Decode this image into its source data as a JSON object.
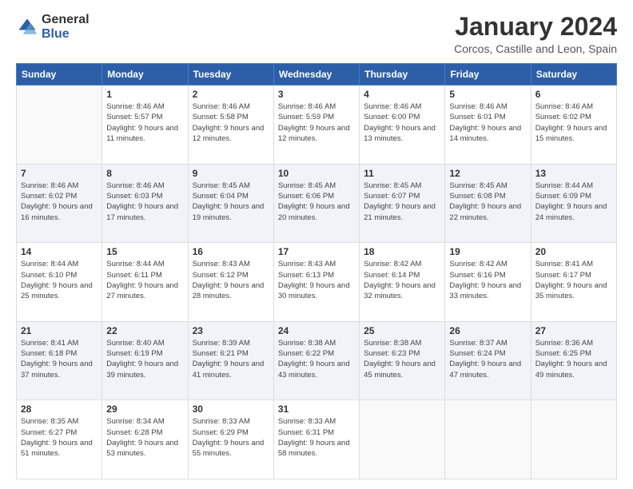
{
  "logo": {
    "general": "General",
    "blue": "Blue"
  },
  "title": "January 2024",
  "location": "Corcos, Castille and Leon, Spain",
  "days_header": [
    "Sunday",
    "Monday",
    "Tuesday",
    "Wednesday",
    "Thursday",
    "Friday",
    "Saturday"
  ],
  "weeks": [
    [
      {
        "day": "",
        "sunrise": "",
        "sunset": "",
        "daylight": ""
      },
      {
        "day": "1",
        "sunrise": "Sunrise: 8:46 AM",
        "sunset": "Sunset: 5:57 PM",
        "daylight": "Daylight: 9 hours and 11 minutes."
      },
      {
        "day": "2",
        "sunrise": "Sunrise: 8:46 AM",
        "sunset": "Sunset: 5:58 PM",
        "daylight": "Daylight: 9 hours and 12 minutes."
      },
      {
        "day": "3",
        "sunrise": "Sunrise: 8:46 AM",
        "sunset": "Sunset: 5:59 PM",
        "daylight": "Daylight: 9 hours and 12 minutes."
      },
      {
        "day": "4",
        "sunrise": "Sunrise: 8:46 AM",
        "sunset": "Sunset: 6:00 PM",
        "daylight": "Daylight: 9 hours and 13 minutes."
      },
      {
        "day": "5",
        "sunrise": "Sunrise: 8:46 AM",
        "sunset": "Sunset: 6:01 PM",
        "daylight": "Daylight: 9 hours and 14 minutes."
      },
      {
        "day": "6",
        "sunrise": "Sunrise: 8:46 AM",
        "sunset": "Sunset: 6:02 PM",
        "daylight": "Daylight: 9 hours and 15 minutes."
      }
    ],
    [
      {
        "day": "7",
        "sunrise": "Sunrise: 8:46 AM",
        "sunset": "Sunset: 6:02 PM",
        "daylight": "Daylight: 9 hours and 16 minutes."
      },
      {
        "day": "8",
        "sunrise": "Sunrise: 8:46 AM",
        "sunset": "Sunset: 6:03 PM",
        "daylight": "Daylight: 9 hours and 17 minutes."
      },
      {
        "day": "9",
        "sunrise": "Sunrise: 8:45 AM",
        "sunset": "Sunset: 6:04 PM",
        "daylight": "Daylight: 9 hours and 19 minutes."
      },
      {
        "day": "10",
        "sunrise": "Sunrise: 8:45 AM",
        "sunset": "Sunset: 6:06 PM",
        "daylight": "Daylight: 9 hours and 20 minutes."
      },
      {
        "day": "11",
        "sunrise": "Sunrise: 8:45 AM",
        "sunset": "Sunset: 6:07 PM",
        "daylight": "Daylight: 9 hours and 21 minutes."
      },
      {
        "day": "12",
        "sunrise": "Sunrise: 8:45 AM",
        "sunset": "Sunset: 6:08 PM",
        "daylight": "Daylight: 9 hours and 22 minutes."
      },
      {
        "day": "13",
        "sunrise": "Sunrise: 8:44 AM",
        "sunset": "Sunset: 6:09 PM",
        "daylight": "Daylight: 9 hours and 24 minutes."
      }
    ],
    [
      {
        "day": "14",
        "sunrise": "Sunrise: 8:44 AM",
        "sunset": "Sunset: 6:10 PM",
        "daylight": "Daylight: 9 hours and 25 minutes."
      },
      {
        "day": "15",
        "sunrise": "Sunrise: 8:44 AM",
        "sunset": "Sunset: 6:11 PM",
        "daylight": "Daylight: 9 hours and 27 minutes."
      },
      {
        "day": "16",
        "sunrise": "Sunrise: 8:43 AM",
        "sunset": "Sunset: 6:12 PM",
        "daylight": "Daylight: 9 hours and 28 minutes."
      },
      {
        "day": "17",
        "sunrise": "Sunrise: 8:43 AM",
        "sunset": "Sunset: 6:13 PM",
        "daylight": "Daylight: 9 hours and 30 minutes."
      },
      {
        "day": "18",
        "sunrise": "Sunrise: 8:42 AM",
        "sunset": "Sunset: 6:14 PM",
        "daylight": "Daylight: 9 hours and 32 minutes."
      },
      {
        "day": "19",
        "sunrise": "Sunrise: 8:42 AM",
        "sunset": "Sunset: 6:16 PM",
        "daylight": "Daylight: 9 hours and 33 minutes."
      },
      {
        "day": "20",
        "sunrise": "Sunrise: 8:41 AM",
        "sunset": "Sunset: 6:17 PM",
        "daylight": "Daylight: 9 hours and 35 minutes."
      }
    ],
    [
      {
        "day": "21",
        "sunrise": "Sunrise: 8:41 AM",
        "sunset": "Sunset: 6:18 PM",
        "daylight": "Daylight: 9 hours and 37 minutes."
      },
      {
        "day": "22",
        "sunrise": "Sunrise: 8:40 AM",
        "sunset": "Sunset: 6:19 PM",
        "daylight": "Daylight: 9 hours and 39 minutes."
      },
      {
        "day": "23",
        "sunrise": "Sunrise: 8:39 AM",
        "sunset": "Sunset: 6:21 PM",
        "daylight": "Daylight: 9 hours and 41 minutes."
      },
      {
        "day": "24",
        "sunrise": "Sunrise: 8:38 AM",
        "sunset": "Sunset: 6:22 PM",
        "daylight": "Daylight: 9 hours and 43 minutes."
      },
      {
        "day": "25",
        "sunrise": "Sunrise: 8:38 AM",
        "sunset": "Sunset: 6:23 PM",
        "daylight": "Daylight: 9 hours and 45 minutes."
      },
      {
        "day": "26",
        "sunrise": "Sunrise: 8:37 AM",
        "sunset": "Sunset: 6:24 PM",
        "daylight": "Daylight: 9 hours and 47 minutes."
      },
      {
        "day": "27",
        "sunrise": "Sunrise: 8:36 AM",
        "sunset": "Sunset: 6:25 PM",
        "daylight": "Daylight: 9 hours and 49 minutes."
      }
    ],
    [
      {
        "day": "28",
        "sunrise": "Sunrise: 8:35 AM",
        "sunset": "Sunset: 6:27 PM",
        "daylight": "Daylight: 9 hours and 51 minutes."
      },
      {
        "day": "29",
        "sunrise": "Sunrise: 8:34 AM",
        "sunset": "Sunset: 6:28 PM",
        "daylight": "Daylight: 9 hours and 53 minutes."
      },
      {
        "day": "30",
        "sunrise": "Sunrise: 8:33 AM",
        "sunset": "Sunset: 6:29 PM",
        "daylight": "Daylight: 9 hours and 55 minutes."
      },
      {
        "day": "31",
        "sunrise": "Sunrise: 8:33 AM",
        "sunset": "Sunset: 6:31 PM",
        "daylight": "Daylight: 9 hours and 58 minutes."
      },
      {
        "day": "",
        "sunrise": "",
        "sunset": "",
        "daylight": ""
      },
      {
        "day": "",
        "sunrise": "",
        "sunset": "",
        "daylight": ""
      },
      {
        "day": "",
        "sunrise": "",
        "sunset": "",
        "daylight": ""
      }
    ]
  ]
}
